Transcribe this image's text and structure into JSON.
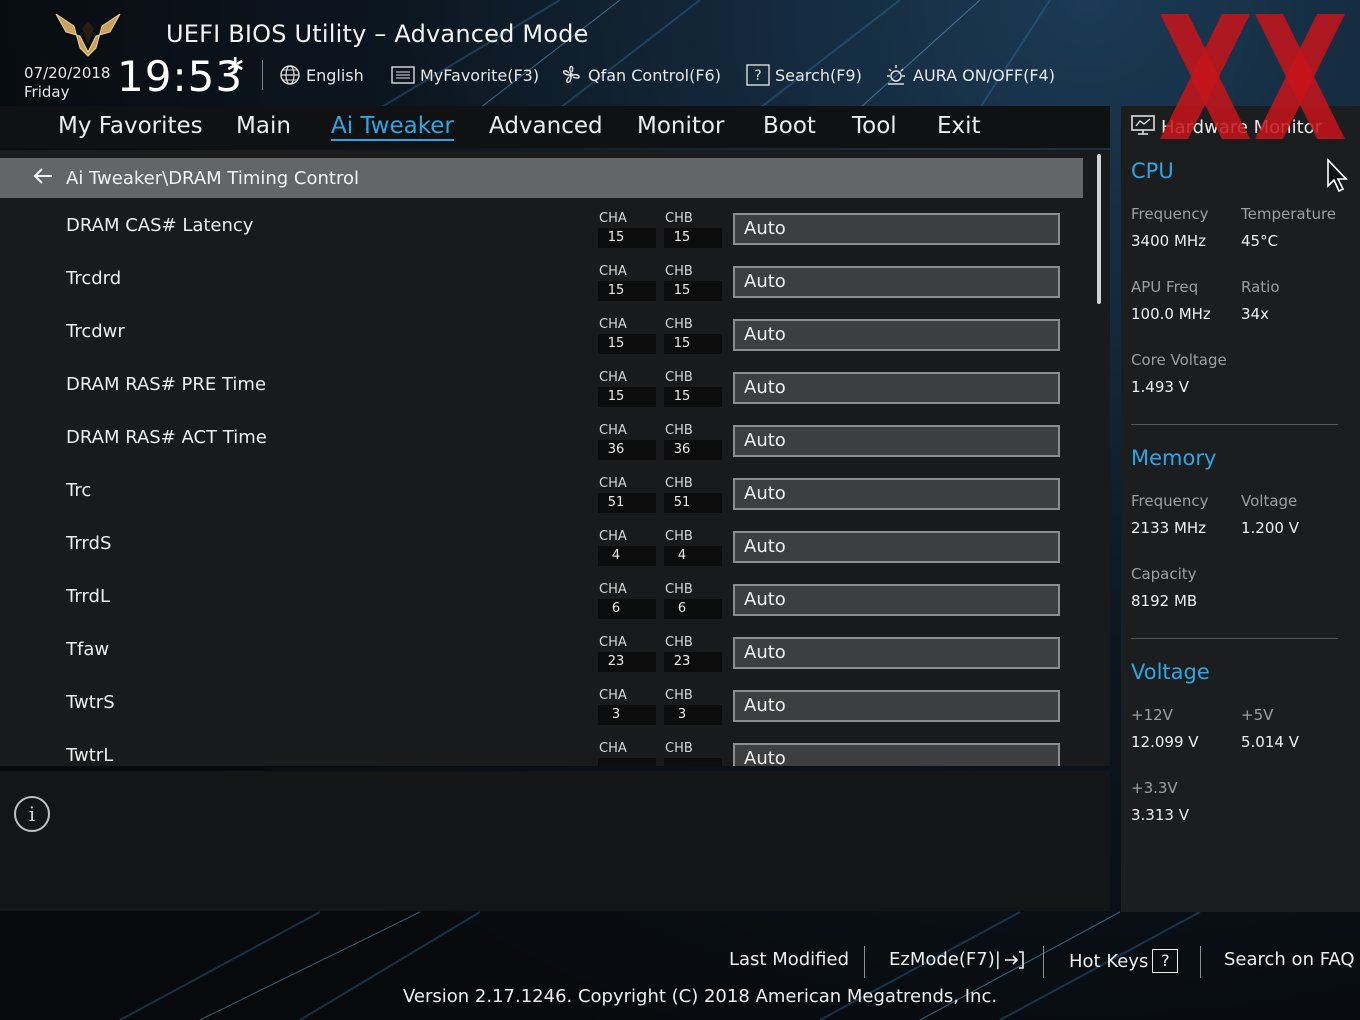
{
  "header": {
    "app_title": "UEFI BIOS Utility – Advanced Mode",
    "date": "07/20/2018",
    "day": "Friday",
    "time": "19:53",
    "toolbar": [
      {
        "name": "language-button",
        "icon": "globe-icon",
        "label": "English"
      },
      {
        "name": "myfavorite-button",
        "icon": "list-icon",
        "label": "MyFavorite(F3)"
      },
      {
        "name": "qfan-control-button",
        "icon": "fan-icon",
        "label": "Qfan Control(F6)"
      },
      {
        "name": "search-button",
        "icon": "question-box-icon",
        "label": "Search(F9)"
      },
      {
        "name": "aura-toggle-button",
        "icon": "sun-icon",
        "label": "AURA ON/OFF(F4)"
      }
    ]
  },
  "tabs": [
    {
      "label": "My Favorites",
      "active": false
    },
    {
      "label": "Main",
      "active": false
    },
    {
      "label": "Ai Tweaker",
      "active": true
    },
    {
      "label": "Advanced",
      "active": false
    },
    {
      "label": "Monitor",
      "active": false
    },
    {
      "label": "Boot",
      "active": false
    },
    {
      "label": "Tool",
      "active": false
    },
    {
      "label": "Exit",
      "active": false
    }
  ],
  "breadcrumb": "Ai Tweaker\\DRAM Timing Control",
  "channel_labels": {
    "a": "CHA",
    "b": "CHB"
  },
  "settings": [
    {
      "label": "DRAM CAS# Latency",
      "cha": "15",
      "chb": "15",
      "value": "Auto"
    },
    {
      "label": "Trcdrd",
      "cha": "15",
      "chb": "15",
      "value": "Auto"
    },
    {
      "label": "Trcdwr",
      "cha": "15",
      "chb": "15",
      "value": "Auto"
    },
    {
      "label": "DRAM RAS# PRE Time",
      "cha": "15",
      "chb": "15",
      "value": "Auto"
    },
    {
      "label": "DRAM RAS# ACT Time",
      "cha": "36",
      "chb": "36",
      "value": "Auto"
    },
    {
      "label": "Trc",
      "cha": "51",
      "chb": "51",
      "value": "Auto"
    },
    {
      "label": "TrrdS",
      "cha": "4",
      "chb": "4",
      "value": "Auto"
    },
    {
      "label": "TrrdL",
      "cha": "6",
      "chb": "6",
      "value": "Auto"
    },
    {
      "label": "Tfaw",
      "cha": "23",
      "chb": "23",
      "value": "Auto"
    },
    {
      "label": "TwtrS",
      "cha": "3",
      "chb": "3",
      "value": "Auto"
    },
    {
      "label": "TwtrL",
      "cha": "",
      "chb": "",
      "value": "Auto"
    }
  ],
  "hardware_monitor": {
    "title": "Hardware Monitor",
    "cpu": {
      "heading": "CPU",
      "frequency_label": "Frequency",
      "frequency": "3400 MHz",
      "temperature_label": "Temperature",
      "temperature": "45°C",
      "apu_freq_label": "APU Freq",
      "apu_freq": "100.0 MHz",
      "ratio_label": "Ratio",
      "ratio": "34x",
      "core_voltage_label": "Core Voltage",
      "core_voltage": "1.493 V"
    },
    "memory": {
      "heading": "Memory",
      "frequency_label": "Frequency",
      "frequency": "2133 MHz",
      "voltage_label": "Voltage",
      "voltage": "1.200 V",
      "capacity_label": "Capacity",
      "capacity": "8192 MB"
    },
    "voltage": {
      "heading": "Voltage",
      "v12_label": "+12V",
      "v12": "12.099 V",
      "v5_label": "+5V",
      "v5": "5.014 V",
      "v33_label": "+3.3V",
      "v33": "3.313 V"
    }
  },
  "footer": {
    "last_modified": "Last Modified",
    "ezmode": "EzMode(F7)|",
    "hot_keys": "Hot Keys",
    "hot_keys_key": "?",
    "search_faq": "Search on FAQ",
    "version": "Version 2.17.1246. Copyright (C) 2018 American Megatrends, Inc."
  },
  "colors": {
    "accent": "#2ea6e6",
    "watermark": "#c8141a"
  }
}
